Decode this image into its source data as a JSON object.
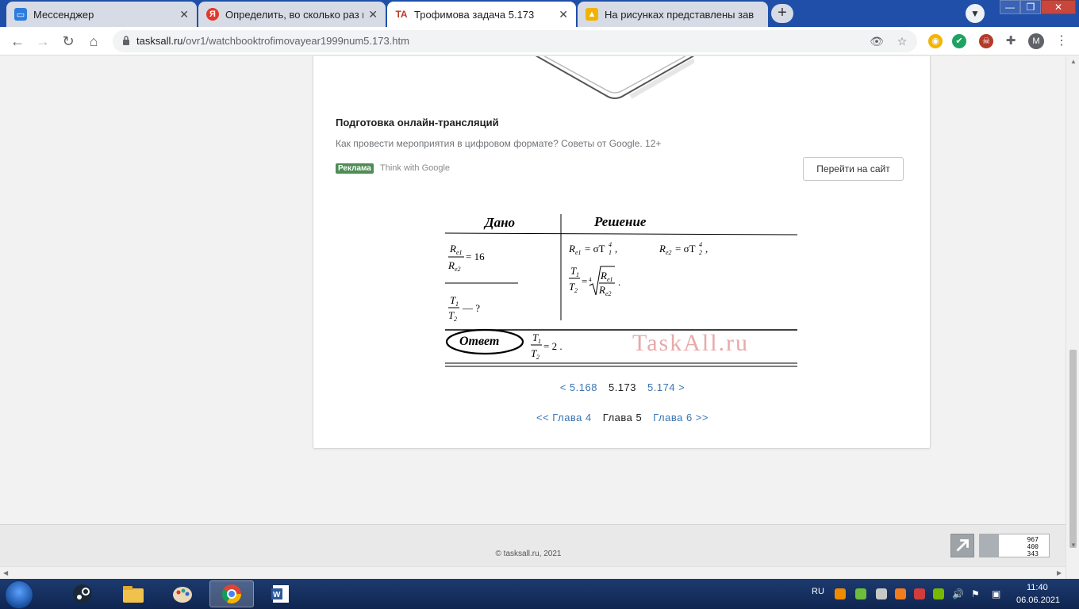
{
  "tabs": [
    {
      "title": "Мессенджер",
      "favicon": "messenger-icon",
      "active": false,
      "color": "#2d7bdf"
    },
    {
      "title": "Определить, во сколько раз нес",
      "favicon": "yandex-icon",
      "active": false,
      "color": "#e2382c"
    },
    {
      "title": "Трофимова задача 5.173",
      "favicon": "taskall-icon",
      "active": true,
      "color": "#c0392b"
    },
    {
      "title": "На рисунках представлены зав",
      "favicon": "image-icon",
      "active": false,
      "color": "#f2b200"
    }
  ],
  "tab_close": "✕",
  "new_tab": "+",
  "address": {
    "host": "tasksall.ru",
    "path": "/ovr1/watchbooktrofimovayear1999num5.173.htm"
  },
  "profile_initial": "M",
  "ad": {
    "title": "Подготовка онлайн-трансляций",
    "description": "Как провести мероприятия в цифровом формате? Советы от Google. 12+",
    "badge": "Реклама",
    "source": "Think with Google",
    "button": "Перейти на сайт"
  },
  "solution": {
    "given_header": "Дано",
    "solution_header": "Решение",
    "answer_label": "Ответ",
    "watermark": "TaskAll.ru",
    "given_ratio_value": "= 16",
    "given_question": "— ?",
    "answer_value": "= 2 ."
  },
  "task_nav": {
    "prev": "< 5.168",
    "current": "5.173",
    "next": "5.174 >"
  },
  "chapter_nav": {
    "prev": "<< Глава 4",
    "current": "Глава 5",
    "next": "Глава 6 >>"
  },
  "footer": {
    "copyright": "© tasksall.ru, 2021",
    "counter": [
      "967",
      "400",
      "343"
    ]
  },
  "taskbar": {
    "lang": "RU",
    "time": "11:40",
    "date": "06.06.2021"
  }
}
